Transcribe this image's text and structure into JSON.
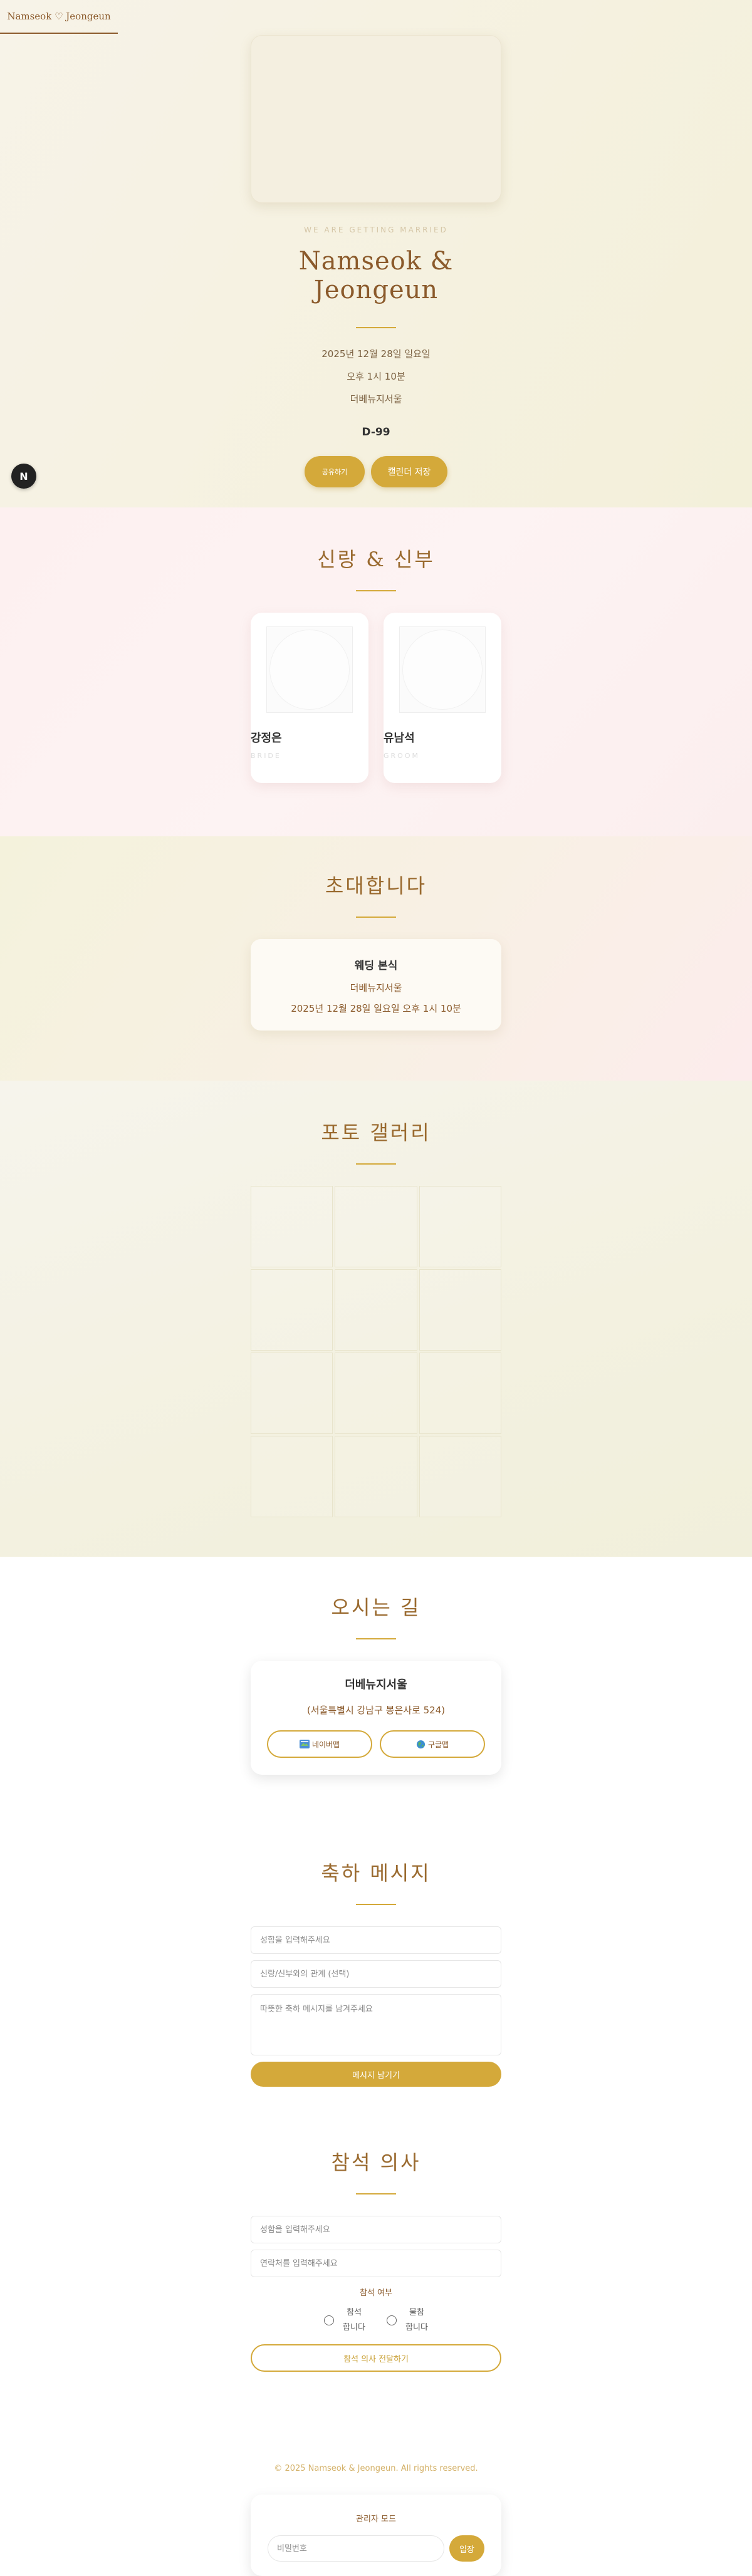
{
  "brand": {
    "label": "Namseok ♡ Jeongeun"
  },
  "fab": {
    "label": "N"
  },
  "hero": {
    "eyebrow": "WE ARE GETTING MARRIED",
    "title": "Namseok & Jeongeun",
    "date": "2025년 12월 28일 일요일",
    "time": "오후 1시 10분",
    "venue": "더베뉴지서울",
    "dday": "D-99",
    "share_label": "공유하기",
    "calendar_label": "캘린더 저장"
  },
  "couple": {
    "title": "신랑 & 신부",
    "bride": {
      "name": "강정은",
      "role": "BRIDE"
    },
    "groom": {
      "name": "유남석",
      "role": "GROOM"
    }
  },
  "invite": {
    "title": "초대합니다",
    "card_title": "웨딩 본식",
    "venue": "더베뉴지서울",
    "datetime": "2025년 12월 28일 일요일 오후 1시 10분"
  },
  "gallery": {
    "title": "포토 갤러리"
  },
  "directions": {
    "title": "오시는 길",
    "venue": "더베뉴지서울",
    "address": "(서울특별시 강남구 봉은사로 524)",
    "naver_label": "네이버맵",
    "google_label": "구글맵",
    "naver_icon": "map-icon",
    "google_icon": "globe-icon"
  },
  "messages": {
    "title": "축하 메시지",
    "name_placeholder": "성함을 입력해주세요",
    "relation_placeholder": "신랑/신부와의 관계 (선택)",
    "message_placeholder": "따뜻한 축하 메시지를 남겨주세요",
    "submit_label": "메시지 남기기"
  },
  "rsvp": {
    "title": "참석 의사",
    "name_placeholder": "성함을 입력해주세요",
    "phone_placeholder": "연락처를 입력해주세요",
    "attendance_label": "참석 여부",
    "option_yes": "참석 합니다",
    "option_no": "불참 합니다",
    "submit_label": "참석 의사 전달하기"
  },
  "footer": {
    "copyright": "© 2025 Namseok & Jeongeun. All rights reserved.",
    "admin_title": "관리자 모드",
    "password_placeholder": "비밀번호",
    "admin_button": "입장"
  },
  "colors": {
    "accent": "#d4a93a",
    "title": "#9a6a2f",
    "brown": "#8b5a2b"
  }
}
